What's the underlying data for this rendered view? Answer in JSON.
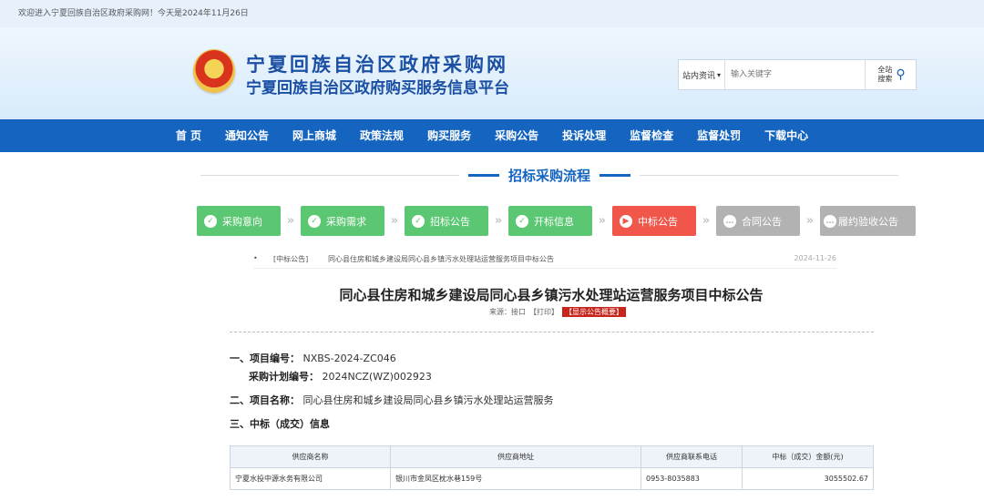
{
  "topbar": {
    "welcome": "欢迎进入宁夏回族自治区政府采购网！今天是2024年11月26日"
  },
  "header": {
    "title_main": "宁夏回族自治区政府采购网",
    "title_sub": "宁夏回族自治区政府购买服务信息平台",
    "search": {
      "scope_selected": "站内资讯",
      "placeholder": "输入关键字",
      "button_label": "全站搜索"
    }
  },
  "nav": {
    "items": [
      "首 页",
      "通知公告",
      "网上商城",
      "政策法规",
      "购买服务",
      "采购公告",
      "投诉处理",
      "监督检查",
      "监督处罚",
      "下载中心"
    ]
  },
  "section": {
    "title": "招标采购流程"
  },
  "steps": [
    {
      "label": "采购意向",
      "status": "done",
      "icon": "check-icon"
    },
    {
      "label": "采购需求",
      "status": "done",
      "icon": "check-icon"
    },
    {
      "label": "招标公告",
      "status": "done",
      "icon": "check-icon"
    },
    {
      "label": "开标信息",
      "status": "done",
      "icon": "check-icon"
    },
    {
      "label": "中标公告",
      "status": "current",
      "icon": "play-icon"
    },
    {
      "label": "合同公告",
      "status": "pending",
      "icon": "more-icon"
    },
    {
      "label": "履约验收公告",
      "status": "pending",
      "icon": "more-icon"
    }
  ],
  "colors": {
    "done": "#5cc773",
    "current": "#f0564a",
    "pending": "#b2b2b2",
    "brand": "#1565c0"
  },
  "listing": {
    "bullet": "•",
    "tag": "[中标公告]",
    "title": "同心县住房和城乡建设局同心县乡镇污水处理站运营服务项目中标公告",
    "date": "2024-11-26"
  },
  "document": {
    "title": "同心县住房和城乡建设局同心县乡镇污水处理站运营服务项目中标公告",
    "source_label": "来源：接口",
    "print_label": "【打印】",
    "summary_label": "【显示公告概要】",
    "sections": {
      "s1_label": "一、项目编号：",
      "s1_value": "NXBS-2024-ZC046",
      "s1b_label": "采购计划编号：",
      "s1b_value": "2024NCZ(WZ)002923",
      "s2_label": "二、项目名称：",
      "s2_value": "同心县住房和城乡建设局同心县乡镇污水处理站运营服务",
      "s3_label": "三、中标（成交）信息"
    },
    "table": {
      "headers": [
        "供应商名称",
        "供应商地址",
        "供应商联系电话",
        "中标（成交）金额(元)"
      ],
      "rows": [
        [
          "宁夏水投中源水务有限公司",
          "银川市金凤区枕水巷159号",
          "0953-8035883",
          "3055502.67"
        ]
      ]
    }
  }
}
